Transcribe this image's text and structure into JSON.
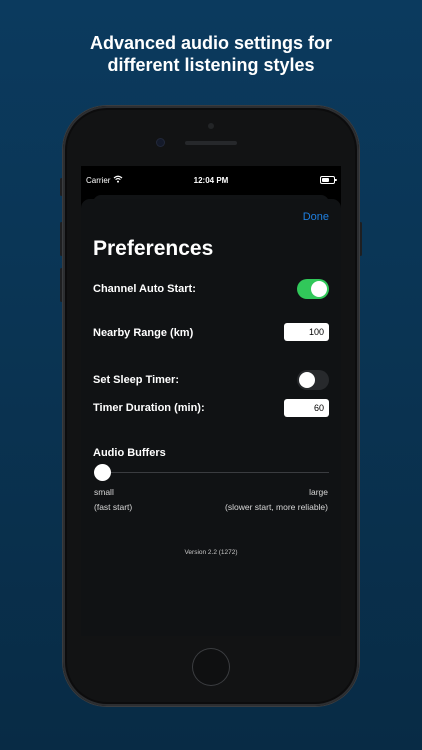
{
  "headline": {
    "line1": "Advanced audio settings for",
    "line2": "different listening styles"
  },
  "statusbar": {
    "carrier": "Carrier",
    "time": "12:04 PM"
  },
  "preferences": {
    "done_label": "Done",
    "title": "Preferences",
    "channel_auto_start": {
      "label": "Channel Auto Start:",
      "on": true
    },
    "nearby_range": {
      "label": "Nearby Range (km)",
      "value": "100"
    },
    "sleep_timer": {
      "label": "Set Sleep Timer:",
      "on": false
    },
    "timer_duration": {
      "label": "Timer Duration (min):",
      "value": "60"
    },
    "audio_buffers": {
      "label": "Audio Buffers",
      "value": 0,
      "min_label": "small",
      "min_hint": "(fast start)",
      "max_label": "large",
      "max_hint": "(slower start, more reliable)"
    },
    "version": "Version 2.2 (1272)"
  },
  "colors": {
    "accent": "#1f7fe0",
    "toggle_on": "#31c85a",
    "background": "#0a3453"
  }
}
